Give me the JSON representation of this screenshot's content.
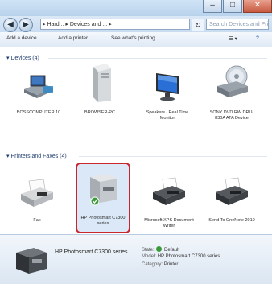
{
  "window": {
    "minimize": "–",
    "maximize": "□",
    "close": "✕"
  },
  "nav": {
    "back": "◀",
    "forward": "▶",
    "address": "▸ Hard... ▸ Devices and ... ▸",
    "refresh": "↻",
    "search_placeholder": "Search Devices and Printers"
  },
  "command_bar": {
    "add_device": "Add a device",
    "add_printer": "Add a printer",
    "see_printing": "See what's printing",
    "view": "☰ ▾",
    "help": "?"
  },
  "groups": {
    "devices": {
      "header": "▾ Devices (4)",
      "items": [
        {
          "label": "BOSSCOMPUTER 10",
          "icon": "computer-icon"
        },
        {
          "label": "BROWSER-PC",
          "icon": "pc-tower-icon"
        },
        {
          "label": "Speakers / Real Time Monitor",
          "icon": "monitor-icon"
        },
        {
          "label": "SONY DVD RW DRU-830A ATA Device",
          "icon": "optical-drive-icon"
        }
      ]
    },
    "printers": {
      "header": "▾ Printers and Faxes (4)",
      "items": [
        {
          "label": "Fax",
          "icon": "fax-icon"
        },
        {
          "label": "HP Photosmart C7300 series",
          "icon": "printer-icon",
          "selected": true,
          "default": true
        },
        {
          "label": "Microsoft XPS Document Writer",
          "icon": "printer-icon"
        },
        {
          "label": "Send To OneNote 2010",
          "icon": "printer-icon"
        }
      ]
    }
  },
  "details": {
    "name": "HP Photosmart C7300 series",
    "state_label": "State:",
    "state_value": "Default",
    "model_label": "Model:",
    "model_value": "HP Photosmart C7300 series",
    "category_label": "Category:",
    "category_value": "Printer"
  },
  "colors": {
    "selection_border": "#c9252c",
    "default_check": "#3a9a3a",
    "header_text": "#1e3b6e"
  }
}
